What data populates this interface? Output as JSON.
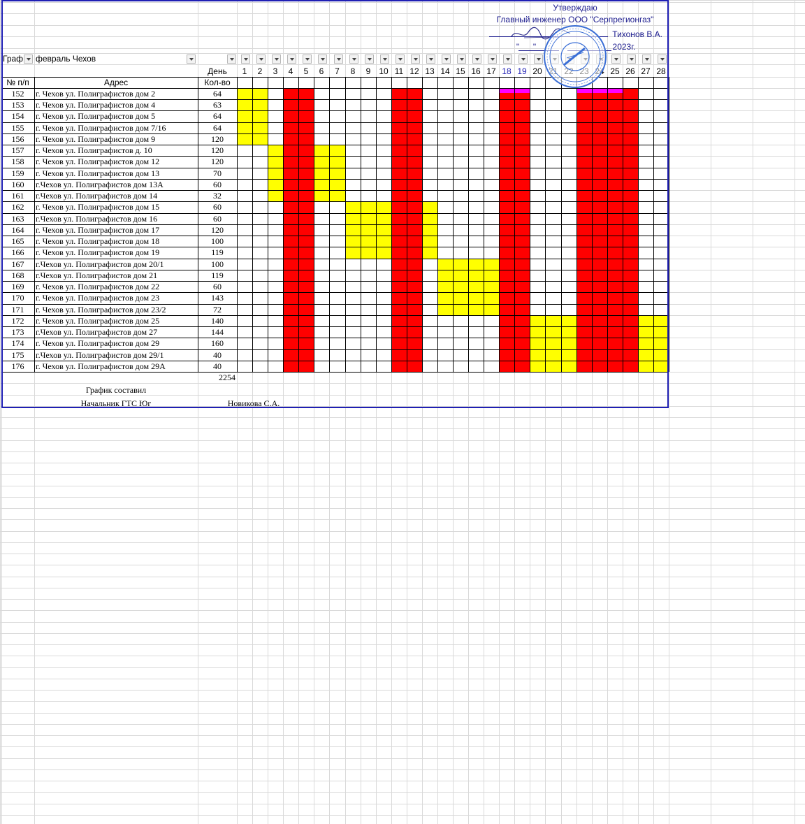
{
  "approval": {
    "line1": "Утверждаю",
    "line2": "Главный инженер ООО \"Серпрегионгаз\"",
    "line3_name": "Тихонов В.А.",
    "line4_quote": "\"",
    "line4_quote2": "\"",
    "line4_year": "2023г."
  },
  "filter_row": {
    "col_a": "Граф",
    "col_b": "февраль Чехов"
  },
  "header": {
    "day_label": "День",
    "num_label": "№ п/п",
    "address_label": "Адрес",
    "qty_label": "Кол-во",
    "days": [
      "1",
      "2",
      "3",
      "4",
      "5",
      "6",
      "7",
      "8",
      "9",
      "10",
      "11",
      "12",
      "13",
      "14",
      "15",
      "16",
      "17",
      "18",
      "19",
      "20",
      "21",
      "22",
      "23",
      "24",
      "25",
      "26",
      "27",
      "28"
    ]
  },
  "rows": [
    {
      "num": "152",
      "address": "г. Чехов ул. Полиграфистов дом 2",
      "qty": "64"
    },
    {
      "num": "153",
      "address": "г. Чехов ул. Полиграфистов дом 4",
      "qty": "63"
    },
    {
      "num": "154",
      "address": "г. Чехов ул. Полиграфистов дом 5",
      "qty": "64"
    },
    {
      "num": "155",
      "address": "г. Чехов ул. Полиграфистов дом 7/16",
      "qty": "64"
    },
    {
      "num": "156",
      "address": "г. Чехов ул. Полиграфистов дом 9",
      "qty": "120"
    },
    {
      "num": "157",
      "address": "г. Чехов ул. Полиграфистов д. 10",
      "qty": "120"
    },
    {
      "num": "158",
      "address": "г. Чехов ул. Полиграфистов дом 12",
      "qty": "120"
    },
    {
      "num": "159",
      "address": "г. Чехов ул. Полиграфистов дом 13",
      "qty": "70"
    },
    {
      "num": "160",
      "address": "г.Чехов ул. Полиграфистов дом 13А",
      "qty": "60"
    },
    {
      "num": "161",
      "address": "г.Чехов ул. Полиграфистов дом 14",
      "qty": "32"
    },
    {
      "num": "162",
      "address": "г. Чехов ул. Полиграфистов дом 15",
      "qty": "60"
    },
    {
      "num": "163",
      "address": "г.Чехов ул. Полиграфистов дом 16",
      "qty": "60"
    },
    {
      "num": "164",
      "address": "г. Чехов ул. Полиграфистов дом 17",
      "qty": "120"
    },
    {
      "num": "165",
      "address": "г. Чехов ул. Полиграфистов дом 18",
      "qty": "100"
    },
    {
      "num": "166",
      "address": "г. Чехов ул. Полиграфистов дом 19",
      "qty": "119"
    },
    {
      "num": "167",
      "address": "г.Чехов ул. Полиграфистов дом 20/1",
      "qty": "100"
    },
    {
      "num": "168",
      "address": "г.Чехов ул. Полиграфистов дом 21",
      "qty": "119"
    },
    {
      "num": "169",
      "address": "г. Чехов ул. Полиграфистов дом 22",
      "qty": "60"
    },
    {
      "num": "170",
      "address": "г. Чехов ул. Полиграфистов дом 23",
      "qty": "143"
    },
    {
      "num": "171",
      "address": "г. Чехов ул. Полиграфистов дом 23/2",
      "qty": "72"
    },
    {
      "num": "172",
      "address": "г. Чехов ул. Полиграфистов дом 25",
      "qty": "140"
    },
    {
      "num": "173",
      "address": "г.Чехов ул. Полиграфистов дом 27",
      "qty": "144"
    },
    {
      "num": "174",
      "address": "г. Чехов ул. Полиграфистов дом 29",
      "qty": "160"
    },
    {
      "num": "175",
      "address": "г.Чехов ул. Полиграфистов дом 29/1",
      "qty": "40"
    },
    {
      "num": "176",
      "address": "г. Чехов ул. Полиграфистов дом 29А",
      "qty": "40"
    }
  ],
  "schedule": {
    "colors": {
      "red": "#ff0000",
      "yellow": "#ffff00",
      "magenta": "#ff00ff"
    },
    "red_days": [
      4,
      5,
      11,
      12,
      18,
      19,
      23,
      24,
      25,
      26
    ],
    "yellow_blocks": [
      {
        "rows": [
          0,
          4
        ],
        "days": [
          1,
          2
        ]
      },
      {
        "rows": [
          5,
          9
        ],
        "days": [
          3,
          3
        ]
      },
      {
        "rows": [
          5,
          9
        ],
        "days": [
          6,
          7
        ]
      },
      {
        "rows": [
          10,
          14
        ],
        "days": [
          8,
          10
        ]
      },
      {
        "rows": [
          10,
          14
        ],
        "days": [
          13,
          13
        ]
      },
      {
        "rows": [
          15,
          19
        ],
        "days": [
          14,
          17
        ]
      },
      {
        "rows": [
          20,
          24
        ],
        "days": [
          20,
          22
        ]
      },
      {
        "rows": [
          20,
          24
        ],
        "days": [
          27,
          28
        ]
      }
    ],
    "magenta_strips": [
      {
        "days": [
          18,
          19
        ]
      },
      {
        "days": [
          23,
          25
        ]
      }
    ]
  },
  "total": "2254",
  "footer": {
    "compiled_by": "График составил",
    "position": "Начальник ГТС Юг",
    "name": "Новикова С.А."
  }
}
